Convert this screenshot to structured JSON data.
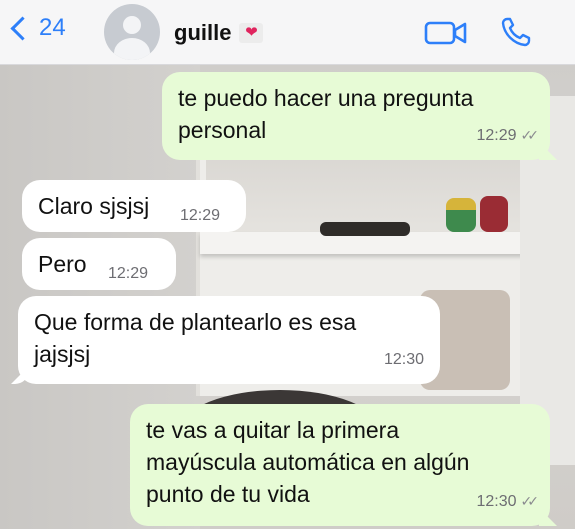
{
  "header": {
    "back_count": "24",
    "contact_name": "guille",
    "contact_badge_icon": "heart-envelope-icon",
    "video_call_icon": "video-camera-icon",
    "voice_call_icon": "phone-icon",
    "accent_color": "#2d7ff9"
  },
  "messages": [
    {
      "direction": "outgoing",
      "text": "te puedo hacer una pregunta personal",
      "time": "12:29",
      "status": "read-ticks"
    },
    {
      "direction": "incoming",
      "text": "Claro sjsjsj",
      "time": "12:29"
    },
    {
      "direction": "incoming",
      "text": "Pero",
      "time": "12:29"
    },
    {
      "direction": "incoming",
      "text": "Que forma de plantearlo es esa jajsjsj",
      "time": "12:30"
    },
    {
      "direction": "outgoing",
      "text": "te vas a quitar la primera mayúscula automática en algún punto de tu vida",
      "time": "12:30",
      "status": "read-ticks"
    }
  ],
  "colors": {
    "outgoing_bubble": "#e7fbd6",
    "incoming_bubble": "#ffffff",
    "header_bg": "#f6f6f7"
  }
}
